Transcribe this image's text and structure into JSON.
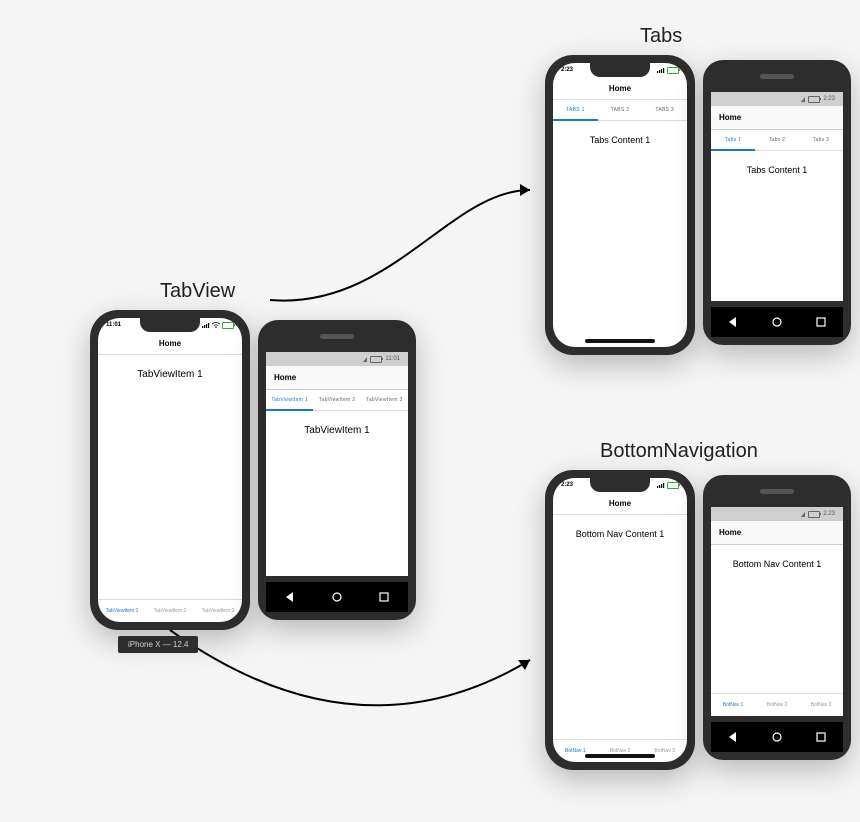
{
  "sections": {
    "tabview": {
      "title": "TabView"
    },
    "tabs": {
      "title": "Tabs"
    },
    "bottomnav": {
      "title": "BottomNavigation"
    }
  },
  "tabview_ios": {
    "time": "11:01",
    "nav_title": "Home",
    "content": "TabViewItem 1",
    "bottom": [
      "TabViewItem 1",
      "TabViewItem 2",
      "TabViewItem 3"
    ],
    "footer_label": "iPhone X — 12.4"
  },
  "tabview_android": {
    "time": "11:01",
    "nav_title": "Home",
    "tabs": [
      "TabViewItem 1",
      "TabViewItem 2",
      "TabViewItem 3"
    ],
    "content": "TabViewItem 1"
  },
  "tabs_ios": {
    "time": "2:23",
    "nav_title": "Home",
    "tabs": [
      "TABS 1",
      "TABS 2",
      "TABS 3"
    ],
    "content": "Tabs Content 1"
  },
  "tabs_android": {
    "time": "2:23",
    "nav_title": "Home",
    "tabs": [
      "Tabs 1",
      "Tabs 2",
      "Tabs 3"
    ],
    "content": "Tabs Content 1"
  },
  "bn_ios": {
    "time": "2:23",
    "nav_title": "Home",
    "content": "Bottom Nav Content 1",
    "bottom": [
      "BotNav 1",
      "BotNav 2",
      "BotNav 3"
    ]
  },
  "bn_android": {
    "time": "2:23",
    "nav_title": "Home",
    "content": "Bottom Nav Content 1",
    "bottom": [
      "BotNav 1",
      "BotNav 2",
      "BotNav 3"
    ]
  }
}
